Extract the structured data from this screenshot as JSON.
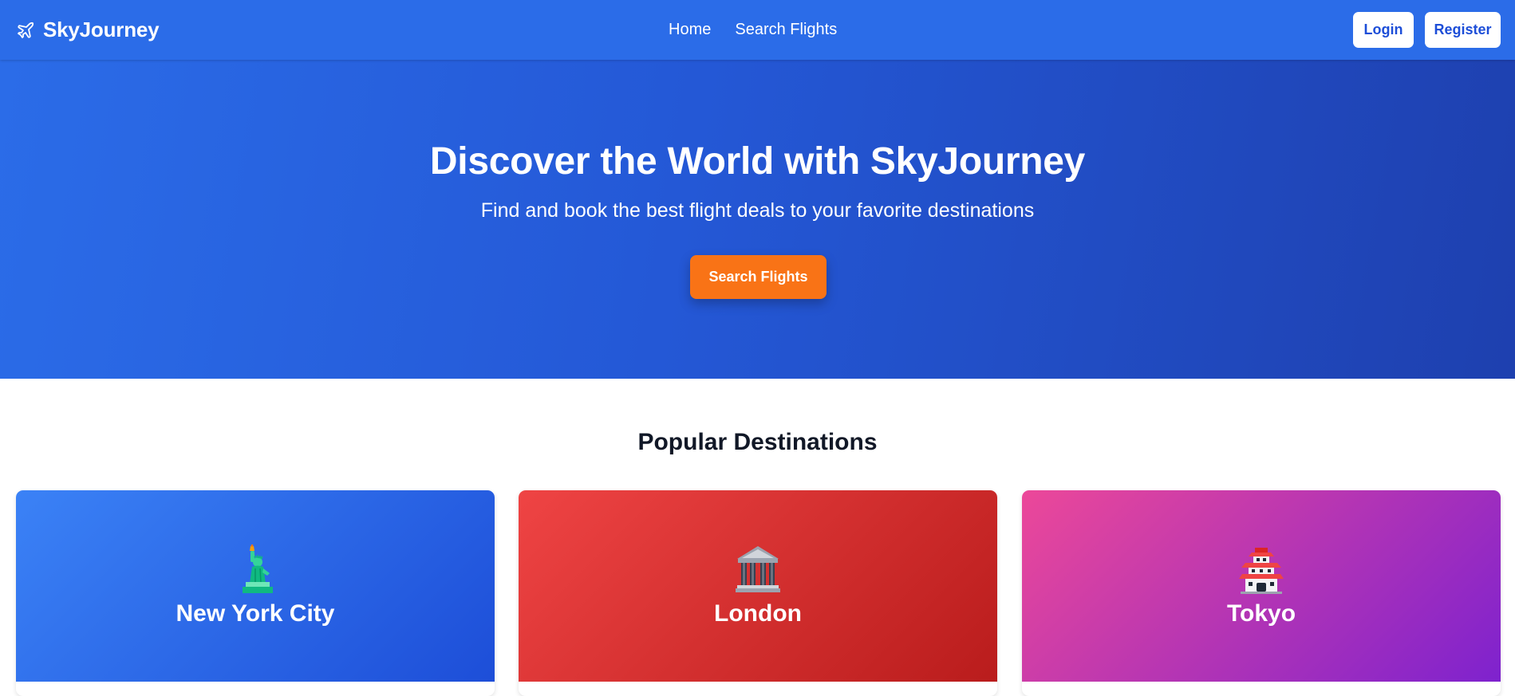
{
  "navbar": {
    "brand": "SkyJourney",
    "brand_icon": "airplane-icon",
    "links": [
      "Home",
      "Search Flights"
    ],
    "login_label": "Login",
    "register_label": "Register",
    "bg_color": "#2b6ce8"
  },
  "hero": {
    "title": "Discover the World with SkyJourney",
    "subtitle": "Find and book the best flight deals to your favorite destinations",
    "cta_label": "Search Flights",
    "cta_color": "#f97316"
  },
  "destinations": {
    "title": "Popular Destinations",
    "items": [
      {
        "name": "New York City",
        "icon": "statue-of-liberty-icon",
        "color": "#2563eb"
      },
      {
        "name": "London",
        "icon": "classical-building-icon",
        "color": "#dc2626"
      },
      {
        "name": "Tokyo",
        "icon": "japanese-castle-icon",
        "color": "#a21caf"
      }
    ]
  }
}
